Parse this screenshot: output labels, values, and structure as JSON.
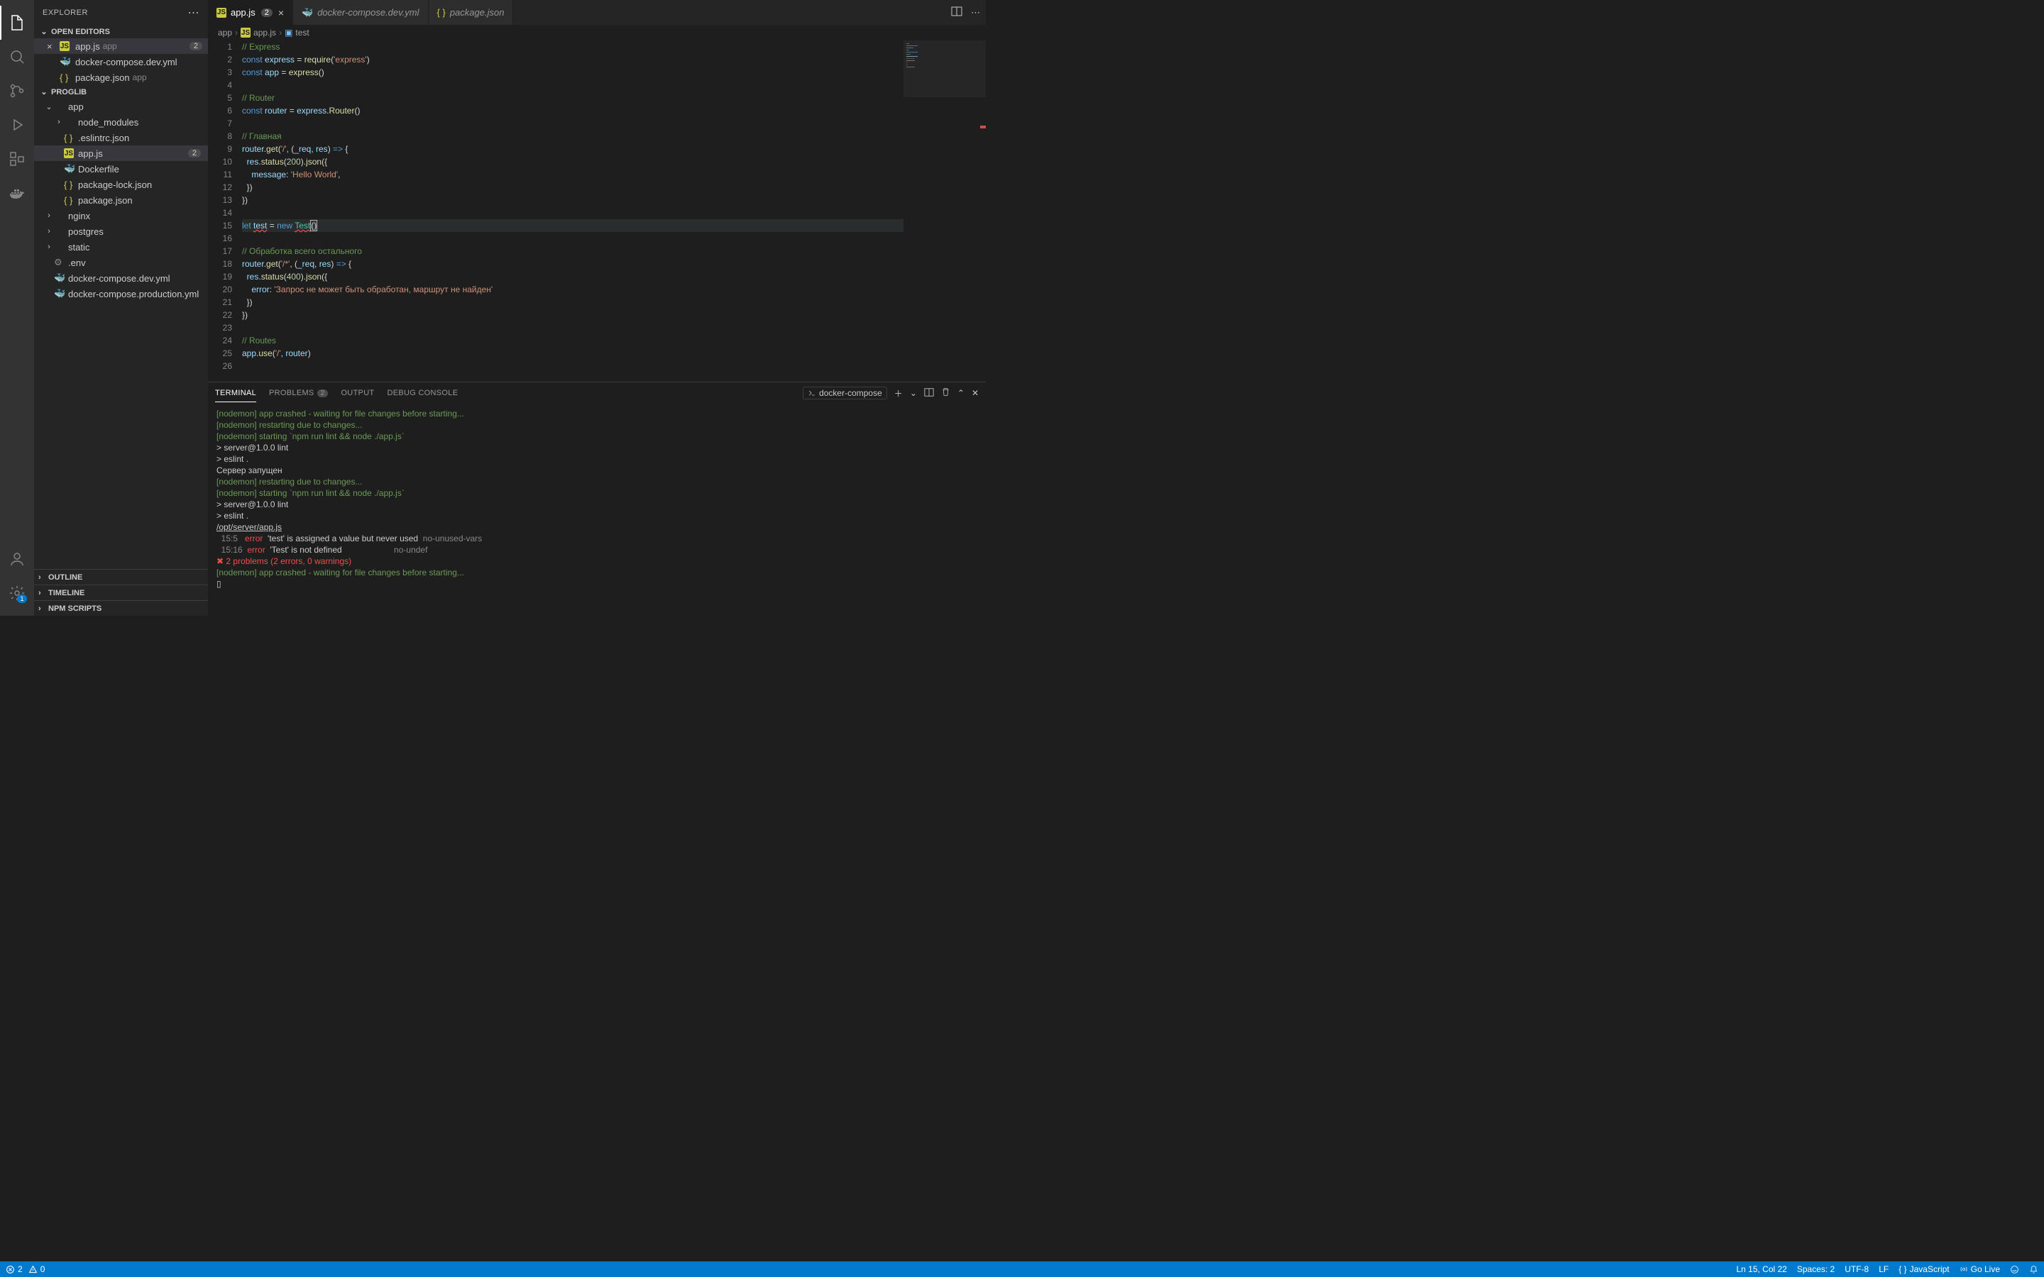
{
  "sidebar": {
    "title": "EXPLORER",
    "openEditorsLabel": "OPEN EDITORS",
    "openEditors": [
      {
        "name": "app.js",
        "dir": "app",
        "badge": "2",
        "active": true,
        "close": true,
        "iconType": "js"
      },
      {
        "name": "docker-compose.dev.yml",
        "dir": "",
        "iconType": "docker"
      },
      {
        "name": "package.json",
        "dir": "app",
        "iconType": "json"
      }
    ],
    "workspaceLabel": "PROGLIB",
    "tree": [
      {
        "type": "folder",
        "name": "app",
        "open": true,
        "indent": 0,
        "modified": true
      },
      {
        "type": "folder",
        "name": "node_modules",
        "open": false,
        "indent": 1
      },
      {
        "type": "file",
        "name": ".eslintrc.json",
        "indent": 1,
        "iconType": "json"
      },
      {
        "type": "file",
        "name": "app.js",
        "indent": 1,
        "active": true,
        "badge": "2",
        "iconType": "js"
      },
      {
        "type": "file",
        "name": "Dockerfile",
        "indent": 1,
        "iconType": "docker"
      },
      {
        "type": "file",
        "name": "package-lock.json",
        "indent": 1,
        "iconType": "json"
      },
      {
        "type": "file",
        "name": "package.json",
        "indent": 1,
        "iconType": "json"
      },
      {
        "type": "folder",
        "name": "nginx",
        "open": false,
        "indent": 0
      },
      {
        "type": "folder",
        "name": "postgres",
        "open": false,
        "indent": 0
      },
      {
        "type": "folder",
        "name": "static",
        "open": false,
        "indent": 0
      },
      {
        "type": "file",
        "name": ".env",
        "indent": 0,
        "iconType": "gear"
      },
      {
        "type": "file",
        "name": "docker-compose.dev.yml",
        "indent": 0,
        "iconType": "docker"
      },
      {
        "type": "file",
        "name": "docker-compose.production.yml",
        "indent": 0,
        "iconType": "docker"
      }
    ],
    "bottomSections": [
      "OUTLINE",
      "TIMELINE",
      "NPM SCRIPTS"
    ]
  },
  "tabs": [
    {
      "name": "app.js",
      "active": true,
      "badge": "2",
      "close": true,
      "iconType": "js"
    },
    {
      "name": "docker-compose.dev.yml",
      "italic": true,
      "iconType": "docker"
    },
    {
      "name": "package.json",
      "italic": true,
      "iconType": "json"
    }
  ],
  "breadcrumb": [
    "app",
    "app.js",
    "test"
  ],
  "code": [
    {
      "n": 1,
      "html": "<span class='c-comment'>// Express</span>"
    },
    {
      "n": 2,
      "html": "<span class='c-kw'>const</span> <span class='c-var'>express</span> = <span class='c-fn'>require</span>(<span class='c-str'>'express'</span>)"
    },
    {
      "n": 3,
      "html": "<span class='c-kw'>const</span> <span class='c-var'>app</span> = <span class='c-fn'>express</span>()"
    },
    {
      "n": 4,
      "html": ""
    },
    {
      "n": 5,
      "html": "<span class='c-comment'>// Router</span>"
    },
    {
      "n": 6,
      "html": "<span class='c-kw'>const</span> <span class='c-var'>router</span> = <span class='c-var'>express</span>.<span class='c-fn'>Router</span>()"
    },
    {
      "n": 7,
      "html": ""
    },
    {
      "n": 8,
      "html": "<span class='c-comment'>// Главная</span>"
    },
    {
      "n": 9,
      "html": "<span class='c-var'>router</span>.<span class='c-fn'>get</span>(<span class='c-str'>'/'</span>, (<span class='c-var'>_req</span>, <span class='c-var'>res</span>) <span class='c-kw'>=&gt;</span> {"
    },
    {
      "n": 10,
      "html": "  <span class='c-var'>res</span>.<span class='c-fn'>status</span>(<span class='c-num'>200</span>).<span class='c-fn'>json</span>({"
    },
    {
      "n": 11,
      "html": "    <span class='c-prop'>message</span>: <span class='c-str'>'Hello World'</span>,"
    },
    {
      "n": 12,
      "html": "  })"
    },
    {
      "n": 13,
      "html": "})"
    },
    {
      "n": 14,
      "html": ""
    },
    {
      "n": 15,
      "current": true,
      "html": "<span class='c-kw'>let</span> <span class='c-var c-err'>test</span> = <span class='c-kw'>new</span> <span class='c-type c-err'>Test</span><span class='cursor-box'>()</span>"
    },
    {
      "n": 16,
      "html": ""
    },
    {
      "n": 17,
      "html": "<span class='c-comment'>// Обработка всего остального</span>"
    },
    {
      "n": 18,
      "html": "<span class='c-var'>router</span>.<span class='c-fn'>get</span>(<span class='c-str'>'/*'</span>, (<span class='c-var'>_req</span>, <span class='c-var'>res</span>) <span class='c-kw'>=&gt;</span> {"
    },
    {
      "n": 19,
      "html": "  <span class='c-var'>res</span>.<span class='c-fn'>status</span>(<span class='c-num'>400</span>).<span class='c-fn'>json</span>({"
    },
    {
      "n": 20,
      "html": "    <span class='c-prop'>error</span>: <span class='c-str'>'Запрос не может быть обработан, маршрут не найден'</span>"
    },
    {
      "n": 21,
      "html": "  })"
    },
    {
      "n": 22,
      "html": "})"
    },
    {
      "n": 23,
      "html": ""
    },
    {
      "n": 24,
      "html": "<span class='c-comment'>// Routes</span>"
    },
    {
      "n": 25,
      "html": "<span class='c-var'>app</span>.<span class='c-fn'>use</span>(<span class='c-str'>'/'</span>, <span class='c-var'>router</span>)"
    },
    {
      "n": 26,
      "html": ""
    }
  ],
  "panel": {
    "tabs": [
      "TERMINAL",
      "PROBLEMS",
      "OUTPUT",
      "DEBUG CONSOLE"
    ],
    "problemsBadge": "2",
    "taskLabel": "docker-compose",
    "terminalLines": [
      {
        "cls": "t-green",
        "text": "[nodemon] app crashed - waiting for file changes before starting..."
      },
      {
        "cls": "t-green",
        "text": "[nodemon] restarting due to changes..."
      },
      {
        "cls": "t-green",
        "text": "[nodemon] starting `npm run lint && node ./app.js`"
      },
      {
        "cls": "",
        "text": ""
      },
      {
        "cls": "",
        "text": "> server@1.0.0 lint"
      },
      {
        "cls": "",
        "text": "> eslint ."
      },
      {
        "cls": "",
        "text": ""
      },
      {
        "cls": "",
        "text": "Сервер запущен"
      },
      {
        "cls": "t-green",
        "text": "[nodemon] restarting due to changes..."
      },
      {
        "cls": "t-green",
        "text": "[nodemon] starting `npm run lint && node ./app.js`"
      },
      {
        "cls": "",
        "text": ""
      },
      {
        "cls": "",
        "text": "> server@1.0.0 lint"
      },
      {
        "cls": "",
        "text": "> eslint ."
      },
      {
        "cls": "",
        "text": ""
      },
      {
        "cls": "",
        "text": ""
      },
      {
        "cls": "t-underline",
        "text": "/opt/server/app.js"
      },
      {
        "cls": "",
        "html": "  <span class='t-dim'>15:5</span>   <span class='t-red'>error</span>  'test' is assigned a value but never used  <span class='t-dim'>no-unused-vars</span>"
      },
      {
        "cls": "",
        "html": "  <span class='t-dim'>15:16</span>  <span class='t-red'>error</span>  'Test' is not defined                      <span class='t-dim'>no-undef</span>"
      },
      {
        "cls": "",
        "text": ""
      },
      {
        "cls": "t-red",
        "text": "✖ 2 problems (2 errors, 0 warnings)"
      },
      {
        "cls": "",
        "text": ""
      },
      {
        "cls": "t-green",
        "text": "[nodemon] app crashed - waiting for file changes before starting..."
      },
      {
        "cls": "",
        "text": "▯"
      }
    ]
  },
  "status": {
    "errors": "2",
    "warnings": "0",
    "position": "Ln 15, Col 22",
    "spaces": "Spaces: 2",
    "encoding": "UTF-8",
    "eol": "LF",
    "language": "JavaScript",
    "goLive": "Go Live",
    "settingsBadge": "1"
  }
}
